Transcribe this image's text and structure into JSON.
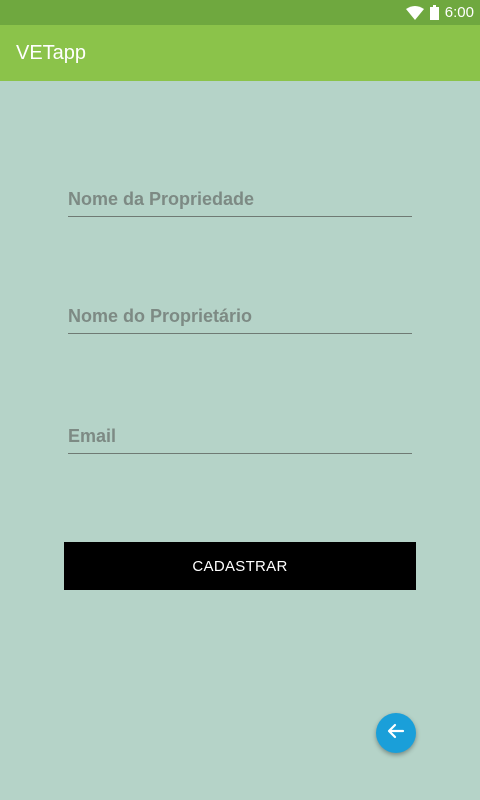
{
  "status_bar": {
    "time": "6:00",
    "icons": [
      "wifi-icon",
      "battery-icon"
    ]
  },
  "app_bar": {
    "title": "VETapp"
  },
  "form": {
    "property_name_placeholder": "Nome da Propriedade",
    "owner_name_placeholder": "Nome do Proprietário",
    "email_placeholder": "Email",
    "submit_label": "CADASTRAR"
  },
  "fab": {
    "icon": "arrow-back-icon"
  },
  "colors": {
    "status_bar": "#6fa83f",
    "app_bar": "#8bc34a",
    "background": "#b5d3c8",
    "button": "#000000",
    "fab": "#1a9fd9"
  }
}
